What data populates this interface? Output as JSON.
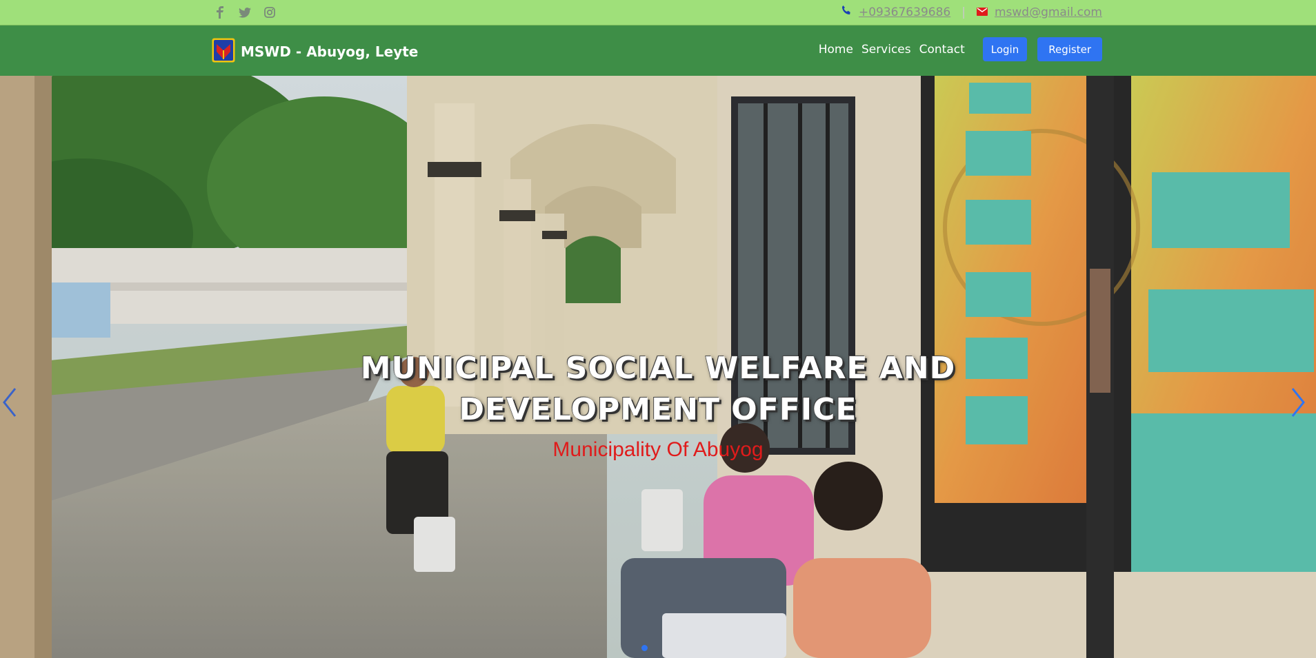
{
  "topbar": {
    "social": [
      {
        "icon": "facebook-icon"
      },
      {
        "icon": "twitter-icon"
      },
      {
        "icon": "instagram-icon"
      }
    ],
    "phone": "+09367639686",
    "email": "mswd@gmail.com",
    "separator": "|"
  },
  "navbar": {
    "brand": "MSWD - Abuyog, Leyte",
    "links": [
      "Home",
      "Services",
      "Contact"
    ],
    "login_label": "Login",
    "register_label": "Register"
  },
  "hero": {
    "title_line1": "MUNICIPAL SOCIAL WELFARE AND",
    "title_line2": "DEVELOPMENT OFFICE",
    "subtitle": "Municipality Of Abuyog"
  },
  "colors": {
    "topbar": "#9fe07a",
    "navbar": "#3e8e47",
    "button": "#2f74f2",
    "subtitle": "#e01b1b"
  }
}
